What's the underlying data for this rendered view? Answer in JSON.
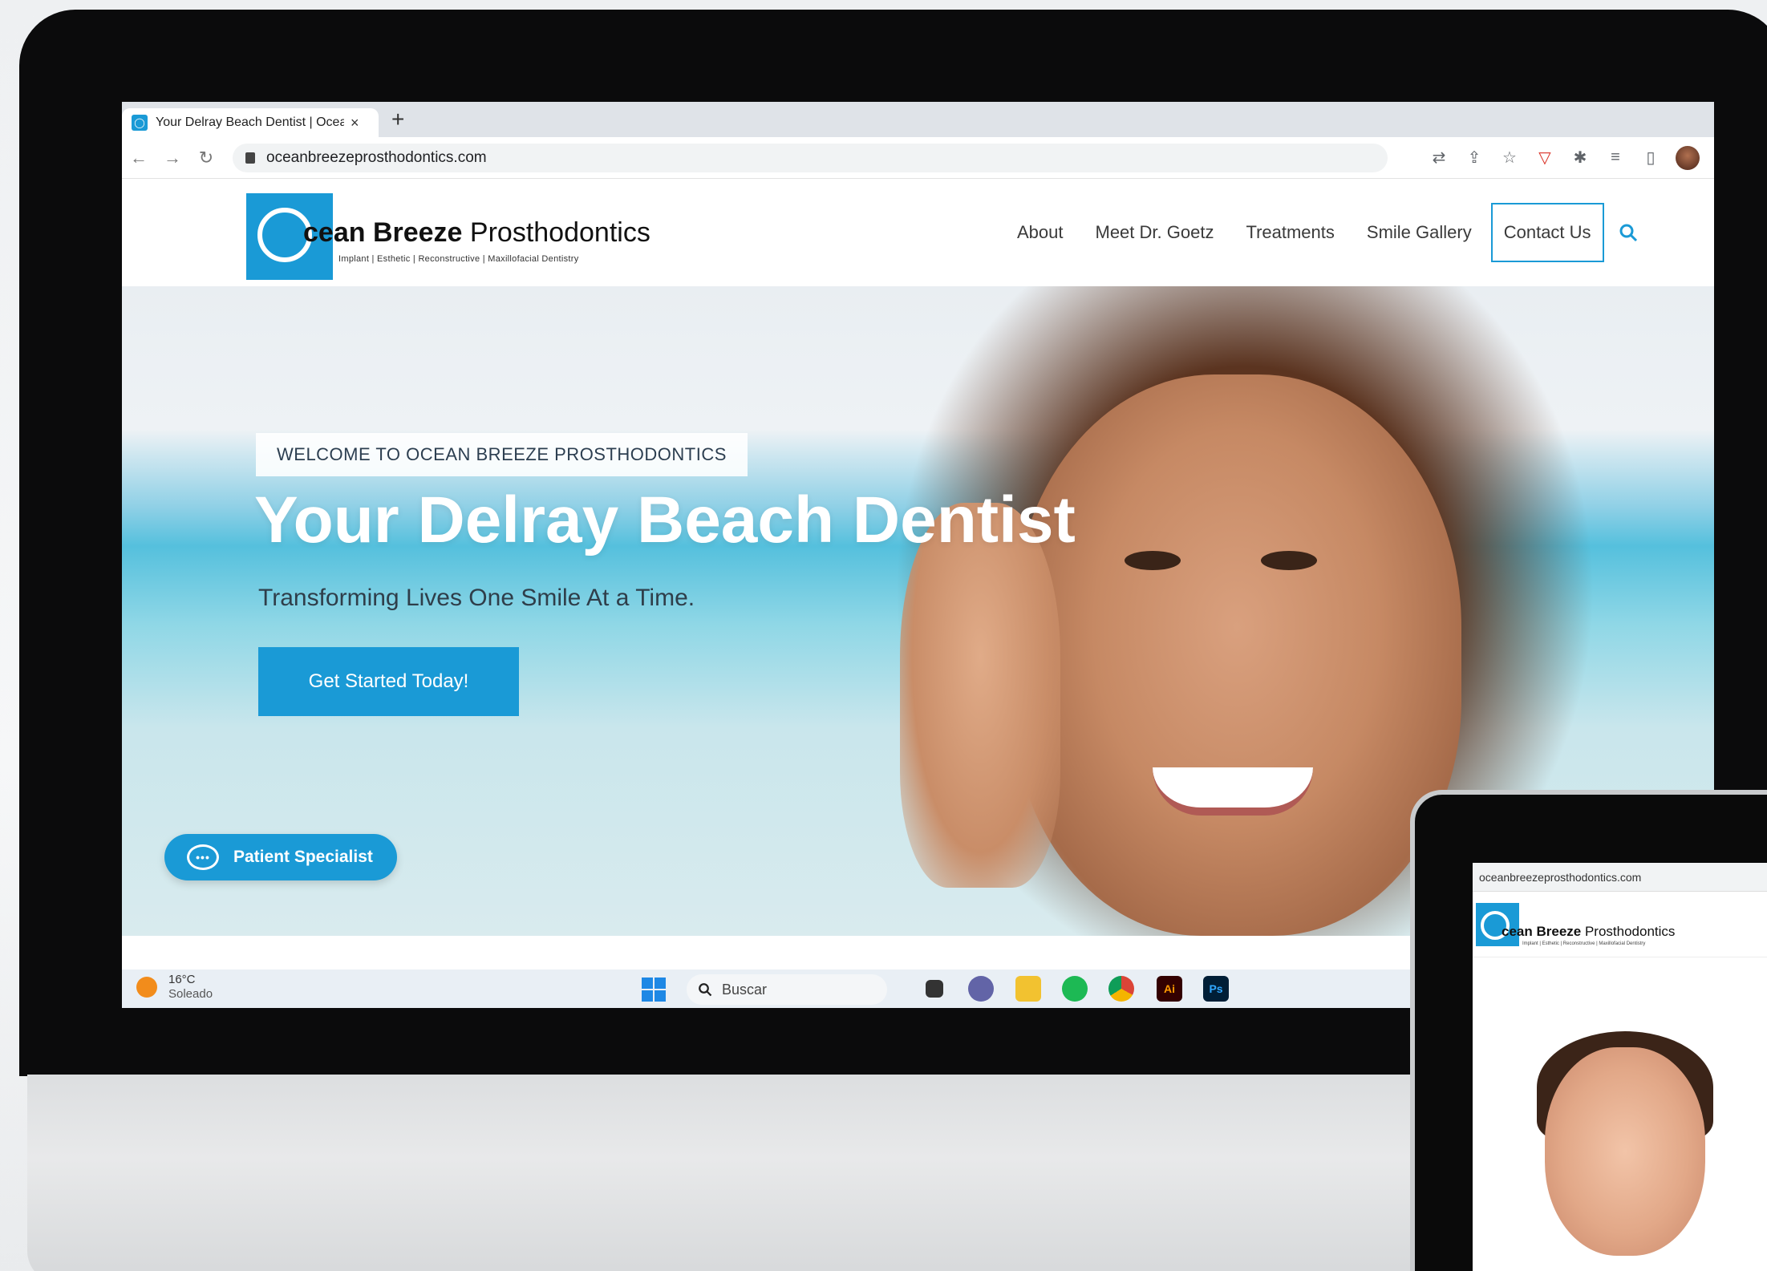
{
  "browser": {
    "tab_title": "Your Delray Beach Dentist | Ocea",
    "tab_close": "×",
    "new_tab": "+",
    "url": "oceanbreezeprosthodontics.com",
    "back": "←",
    "forward": "→",
    "reload": "↻",
    "extensions": [
      "translate-icon",
      "share-icon",
      "star-icon",
      "pocket-icon",
      "puzzle-icon",
      "reading-list-icon",
      "side-panel-icon",
      "profile-avatar"
    ]
  },
  "site": {
    "logo": {
      "text_bold": "cean Breeze",
      "text_regular": " Prosthodontics",
      "tagline": "Implant | Esthetic | Reconstructive | Maxillofacial Dentistry"
    },
    "nav": [
      {
        "label": "About"
      },
      {
        "label": "Meet Dr. Goetz"
      },
      {
        "label": "Treatments"
      },
      {
        "label": "Smile Gallery"
      },
      {
        "label": "Contact Us"
      }
    ],
    "hero": {
      "badge": "WELCOME TO OCEAN BREEZE PROSTHODONTICS",
      "title": "Your Delray Beach Dentist",
      "subtitle": "Transforming Lives One Smile At a Time.",
      "cta": "Get Started Today!"
    },
    "chat": {
      "label": "Patient Specialist",
      "icon_dots": "•••"
    }
  },
  "taskbar": {
    "weather_temp": "16°C",
    "weather_desc": "Soleado",
    "search_placeholder": "Buscar",
    "apps": [
      {
        "name": "files-app",
        "label": ""
      },
      {
        "name": "teams-app",
        "label": ""
      },
      {
        "name": "explorer-app",
        "label": ""
      },
      {
        "name": "spotify-app",
        "label": ""
      },
      {
        "name": "chrome-app",
        "label": ""
      },
      {
        "name": "illustrator-app",
        "label": "Ai"
      },
      {
        "name": "photoshop-app",
        "label": "Ps"
      }
    ]
  },
  "tablet": {
    "url": "oceanbreezeprosthodontics.com",
    "logo_bold": "cean Breeze",
    "logo_regular": " Prosthodontics",
    "tagline": "Implant | Esthetic | Reconstructive | Maxillofacial Dentistry"
  },
  "colors": {
    "brand_blue": "#1a9ad6",
    "monitor_bezel": "#0b0b0c",
    "hero_title": "#ffffff"
  }
}
